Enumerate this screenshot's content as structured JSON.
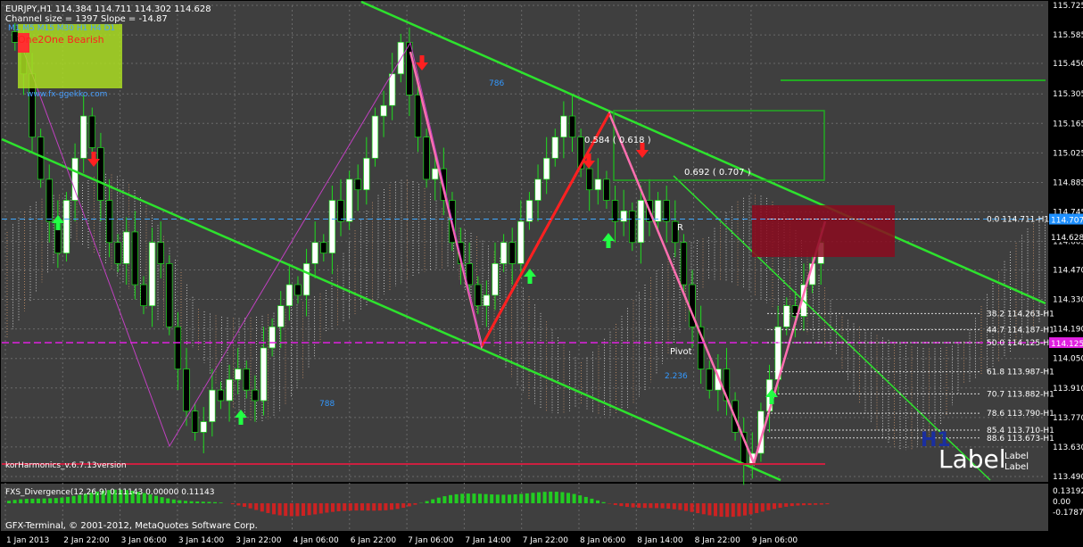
{
  "header": {
    "symbol_line": "EURJPY,H1  114.384 114.711 114.302 114.628",
    "channel_line": "Channel size = 1397 Slope = -14.87",
    "tf_row": "M1 M5 M15 M30 H1 H4 D1",
    "panel_title": "One2One Bearish",
    "site": "www.fx-ggekko.com"
  },
  "colors": {
    "background": "#000000",
    "plot_bg": "#3f3f3f",
    "grid": "#6a6a6a",
    "bull_candle": "#ffffff",
    "bear_candle": "#000000",
    "wick_green": "#1fdc1f",
    "channel": "#2de22d",
    "harmonic_pink": "#ff6fb0",
    "harmonic_red": "#ff2020",
    "pivot_magenta": "#e020e0",
    "price_tag_blue": "#1e90ff",
    "zone_red": "#8b0a1e"
  },
  "annotations": {
    "ret1": "0.584 ( 0.618 )",
    "ret2": "0.692 ( 0.707 )",
    "pivot": "Pivot",
    "ext": "2.236",
    "num786": "786",
    "num788": "788",
    "r_lbl": "R",
    "h1": "H1",
    "label_big": "Label",
    "label_small1": "Label",
    "label_small2": "Label",
    "version": "korHarmonics_v.6.7.13version",
    "copyright": "GFX-Terminal, © 2001-2012, MetaQuotes Software Corp."
  },
  "price_tags": {
    "current": "114.628",
    "blue": "114.707",
    "magenta": "114.125"
  },
  "level_labels": [
    {
      "text": "0.0 114.711-H1",
      "price": 114.711
    },
    {
      "text": "38.2 114.263-H1",
      "price": 114.263
    },
    {
      "text": "44.7 114.187-H1",
      "price": 114.187
    },
    {
      "text": "50.0 114.125-H1",
      "price": 114.125
    },
    {
      "text": "61.8 113.987-H1",
      "price": 113.987
    },
    {
      "text": "70.7 113.882-H1",
      "price": 113.882
    },
    {
      "text": "78.6 113.790-H1",
      "price": 113.79
    },
    {
      "text": "85.4 113.710-H1",
      "price": 113.71
    },
    {
      "text": "88.6 113.673-H1",
      "price": 113.673
    }
  ],
  "indicator": {
    "title": "FXS_Divergence(12,26,9) 0.11143 0.00000 0.11143",
    "ticks": [
      "0.13192",
      "0.00",
      "-0.17874"
    ]
  },
  "chart_data": {
    "type": "candlestick",
    "symbol": "EURJPY",
    "timeframe": "H1",
    "ylim": [
      113.49,
      115.725
    ],
    "y_ticks": [
      115.725,
      115.585,
      115.45,
      115.305,
      115.165,
      115.025,
      114.885,
      114.745,
      114.605,
      114.47,
      114.33,
      114.19,
      114.05,
      113.91,
      113.77,
      113.63,
      113.49
    ],
    "x_tick_labels": [
      "1 Jan 2013",
      "2 Jan 22:00",
      "3 Jan 06:00",
      "3 Jan 14:00",
      "3 Jan 22:00",
      "4 Jan 06:00",
      "6 Jan 22:00",
      "7 Jan 06:00",
      "7 Jan 14:00",
      "7 Jan 22:00",
      "8 Jan 06:00",
      "8 Jan 14:00",
      "8 Jan 22:00",
      "9 Jan 06:00"
    ],
    "close_path": [
      115.55,
      115.4,
      115.1,
      114.9,
      114.7,
      114.55,
      114.8,
      115.0,
      115.2,
      115.05,
      114.8,
      114.6,
      114.5,
      114.65,
      114.4,
      114.3,
      114.6,
      114.5,
      114.2,
      114.0,
      113.8,
      113.7,
      113.75,
      113.9,
      113.85,
      113.95,
      114.0,
      113.9,
      113.85,
      114.1,
      114.2,
      114.3,
      114.4,
      114.35,
      114.5,
      114.6,
      114.55,
      114.8,
      114.7,
      114.9,
      114.85,
      115.0,
      115.2,
      115.25,
      115.4,
      115.55,
      115.3,
      115.1,
      114.9,
      114.95,
      114.8,
      114.6,
      114.5,
      114.4,
      114.3,
      114.35,
      114.5,
      114.6,
      114.5,
      114.7,
      114.8,
      114.9,
      115.0,
      115.1,
      115.2,
      115.1,
      114.95,
      114.85,
      114.9,
      114.8,
      114.7,
      114.75,
      114.6,
      114.8,
      114.7,
      114.8,
      114.7,
      114.6,
      114.4,
      114.2,
      114.0,
      113.9,
      114.0,
      113.85,
      113.7,
      113.55,
      113.6,
      113.8,
      113.95,
      114.2,
      114.3,
      114.25,
      114.4,
      114.5,
      114.6
    ]
  }
}
